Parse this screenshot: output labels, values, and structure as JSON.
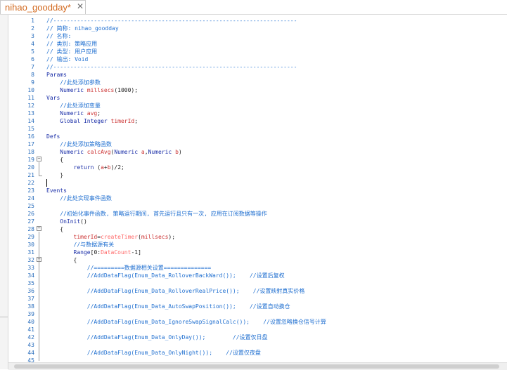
{
  "tab": {
    "title": "nihao_goodday*",
    "close": "✕"
  },
  "lines": [
    {
      "n": "1",
      "parts": [
        [
          "cmt",
          "//------------------------------------------------------------------------"
        ]
      ]
    },
    {
      "n": "2",
      "parts": [
        [
          "cmt",
          "// 简称: nihao_goodday"
        ]
      ]
    },
    {
      "n": "3",
      "parts": [
        [
          "cmt",
          "// 名称:"
        ]
      ]
    },
    {
      "n": "4",
      "parts": [
        [
          "cmt",
          "// 类别: 策略应用"
        ]
      ]
    },
    {
      "n": "5",
      "parts": [
        [
          "cmt",
          "// 类型: 用户应用"
        ]
      ]
    },
    {
      "n": "6",
      "parts": [
        [
          "cmt",
          "// 输出: Void"
        ]
      ]
    },
    {
      "n": "7",
      "parts": [
        [
          "cmt",
          "//------------------------------------------------------------------------"
        ]
      ]
    },
    {
      "n": "8",
      "parts": [
        [
          "kw",
          "Params"
        ]
      ]
    },
    {
      "n": "9",
      "parts": [
        [
          "cmt",
          "    //此处添加参数"
        ]
      ]
    },
    {
      "n": "10",
      "parts": [
        [
          "kw",
          "    Numeric "
        ],
        [
          "id",
          "millsecs"
        ],
        [
          "plain",
          "(1000);"
        ]
      ]
    },
    {
      "n": "11",
      "parts": [
        [
          "kw",
          "Vars"
        ]
      ]
    },
    {
      "n": "12",
      "parts": [
        [
          "cmt",
          "    //此处添加变量"
        ]
      ]
    },
    {
      "n": "13",
      "parts": [
        [
          "kw",
          "    Numeric "
        ],
        [
          "id",
          "avg"
        ],
        [
          "plain",
          ";"
        ]
      ]
    },
    {
      "n": "14",
      "parts": [
        [
          "kw",
          "    Global Integer "
        ],
        [
          "id",
          "timerId"
        ],
        [
          "plain",
          ";"
        ]
      ]
    },
    {
      "n": "15",
      "parts": []
    },
    {
      "n": "16",
      "parts": [
        [
          "kw",
          "Defs"
        ]
      ]
    },
    {
      "n": "17",
      "parts": [
        [
          "cmt",
          "    //此处添加策略函数"
        ]
      ]
    },
    {
      "n": "18",
      "parts": [
        [
          "kw",
          "    Numeric "
        ],
        [
          "id",
          "calcAvg"
        ],
        [
          "plain",
          "("
        ],
        [
          "kw",
          "Numeric "
        ],
        [
          "id",
          "a"
        ],
        [
          "plain",
          ","
        ],
        [
          "kw",
          "Numeric "
        ],
        [
          "id",
          "b"
        ],
        [
          "plain",
          ")"
        ]
      ]
    },
    {
      "n": "19",
      "parts": [
        [
          "plain",
          "    {"
        ]
      ]
    },
    {
      "n": "20",
      "parts": [
        [
          "kw",
          "        return "
        ],
        [
          "plain",
          "("
        ],
        [
          "id",
          "a"
        ],
        [
          "plain",
          "+"
        ],
        [
          "id",
          "b"
        ],
        [
          "plain",
          ")/2;"
        ]
      ]
    },
    {
      "n": "21",
      "parts": [
        [
          "plain",
          "    }"
        ]
      ]
    },
    {
      "n": "22",
      "parts": []
    },
    {
      "n": "23",
      "parts": [
        [
          "kw",
          "Events"
        ]
      ]
    },
    {
      "n": "24",
      "parts": [
        [
          "cmt",
          "    //此处实现事件函数"
        ]
      ]
    },
    {
      "n": "25",
      "parts": []
    },
    {
      "n": "26",
      "parts": [
        [
          "cmt",
          "    //初始化事件函数, 策略运行期间, 首先运行且只有一次, 应用在订阅数据等操作"
        ]
      ]
    },
    {
      "n": "27",
      "parts": [
        [
          "kw",
          "    OnInit"
        ],
        [
          "plain",
          "()"
        ]
      ]
    },
    {
      "n": "28",
      "parts": [
        [
          "plain",
          "    {"
        ]
      ]
    },
    {
      "n": "29",
      "parts": [
        [
          "id",
          "        timerId"
        ],
        [
          "plain",
          "="
        ],
        [
          "str",
          "createTimer"
        ],
        [
          "plain",
          "("
        ],
        [
          "id",
          "millsecs"
        ],
        [
          "plain",
          ");"
        ]
      ]
    },
    {
      "n": "30",
      "parts": [
        [
          "cmt",
          "        //与数据源有关"
        ]
      ]
    },
    {
      "n": "31",
      "parts": [
        [
          "kw",
          "        Range"
        ],
        [
          "plain",
          "[0:"
        ],
        [
          "str",
          "DataCount"
        ],
        [
          "plain",
          "-1]"
        ]
      ]
    },
    {
      "n": "32",
      "parts": [
        [
          "plain",
          "        {"
        ]
      ]
    },
    {
      "n": "33",
      "parts": [
        [
          "cmt",
          "            //=========数据源相关设置=============="
        ]
      ]
    },
    {
      "n": "34",
      "parts": [
        [
          "cmt",
          "            //AddDataFlag(Enum_Data_RolloverBackWard());    //设置后复权"
        ]
      ]
    },
    {
      "n": "35",
      "parts": []
    },
    {
      "n": "36",
      "parts": [
        [
          "cmt",
          "            //AddDataFlag(Enum_Data_RolloverRealPrice());    //设置映射真实价格"
        ]
      ]
    },
    {
      "n": "37",
      "parts": []
    },
    {
      "n": "38",
      "parts": [
        [
          "cmt",
          "            //AddDataFlag(Enum_Data_AutoSwapPosition());    //设置自动换仓"
        ]
      ]
    },
    {
      "n": "39",
      "parts": []
    },
    {
      "n": "40",
      "parts": [
        [
          "cmt",
          "            //AddDataFlag(Enum_Data_IgnoreSwapSignalCalc());    //设置忽略换仓信号计算"
        ]
      ]
    },
    {
      "n": "41",
      "parts": []
    },
    {
      "n": "42",
      "parts": [
        [
          "cmt",
          "            //AddDataFlag(Enum_Data_OnlyDay());        //设置仅日盘"
        ]
      ]
    },
    {
      "n": "43",
      "parts": []
    },
    {
      "n": "44",
      "parts": [
        [
          "cmt",
          "            //AddDataFlag(Enum_Data_OnlyNight());    //设置仅夜盘"
        ]
      ]
    },
    {
      "n": "45",
      "parts": []
    }
  ],
  "fold_marks": {
    "minus": "−"
  },
  "colors": {
    "tab_title": "#d2691e",
    "line_number": "#2a6ebd",
    "comment": "#1f6fd0",
    "keyword": "#1b2fa8",
    "identifier": "#cc3333"
  }
}
